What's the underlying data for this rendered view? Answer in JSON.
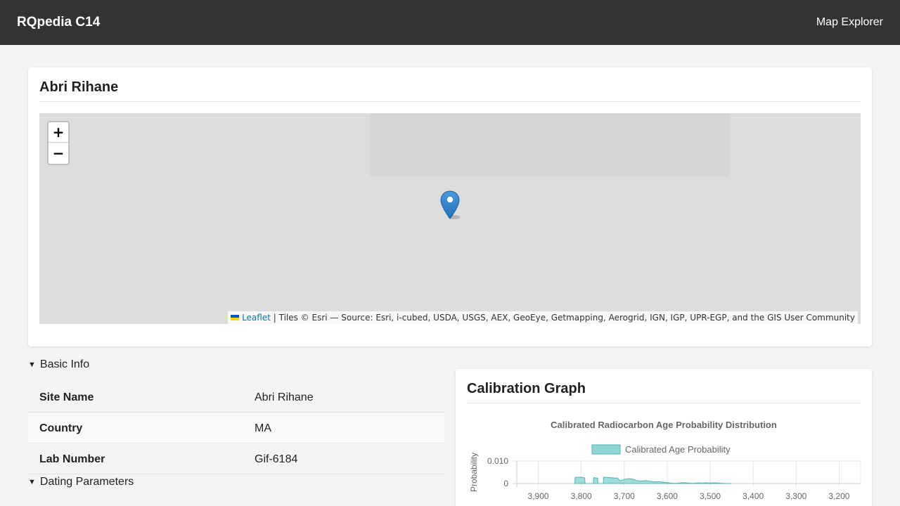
{
  "header": {
    "brand": "RQpedia C14",
    "nav_link": "Map Explorer"
  },
  "site": {
    "title": "Abri Rihane",
    "map": {
      "zoom_in": "+",
      "zoom_out": "−",
      "attribution_link": "Leaflet",
      "attribution_text": "| Tiles © Esri — Source: Esri, i-cubed, USDA, USGS, AEX, GeoEye, Getmapping, Aerogrid, IGN, IGP, UPR-EGP, and the GIS User Community"
    }
  },
  "basic_info": {
    "summary": "Basic Info",
    "rows": [
      {
        "label": "Site Name",
        "value": "Abri Rihane"
      },
      {
        "label": "Country",
        "value": "MA"
      },
      {
        "label": "Lab Number",
        "value": "Gif-6184"
      }
    ]
  },
  "dating": {
    "summary": "Dating Parameters"
  },
  "calibration": {
    "title": "Calibration Graph"
  },
  "chart_data": {
    "type": "area",
    "title": "Calibrated Radiocarbon Age Probability Distribution",
    "xlabel": "",
    "ylabel": "Probability",
    "legend": {
      "label": "Calibrated Age Probability",
      "position": "top"
    },
    "color": "#8fd6d3",
    "stroke": "#4fb3b0",
    "x_reversed": true,
    "xlim": [
      3950,
      3150
    ],
    "ylim": [
      0,
      0.01
    ],
    "x_ticks": [
      3900,
      3800,
      3700,
      3600,
      3500,
      3400,
      3300,
      3200
    ],
    "x_tick_labels": [
      "3,900",
      "3,800",
      "3,700",
      "3,600",
      "3,500",
      "3,400",
      "3,300",
      "3,200"
    ],
    "y_ticks": [
      0,
      0.01
    ],
    "y_tick_labels": [
      "0",
      "0.010"
    ],
    "grid": true,
    "series": [
      {
        "name": "Calibrated Age Probability",
        "x": [
          3815,
          3814,
          3810,
          3800,
          3792,
          3791,
          3790,
          3780,
          3772,
          3771,
          3762,
          3761,
          3760,
          3750,
          3749,
          3748,
          3747,
          3740,
          3730,
          3720,
          3716,
          3710,
          3700,
          3690,
          3680,
          3670,
          3660,
          3650,
          3640,
          3630,
          3620,
          3610,
          3600,
          3590,
          3580,
          3570,
          3560,
          3550,
          3540,
          3530,
          3520,
          3510,
          3500,
          3490,
          3480,
          3470,
          3460,
          3450
        ],
        "y": [
          0,
          0.0028,
          0.0028,
          0.0028,
          0.0025,
          0,
          0,
          0,
          0,
          0.0026,
          0.0024,
          0,
          0,
          0,
          0,
          0.0028,
          0.0028,
          0.0027,
          0.0026,
          0.0024,
          0.0025,
          0.0012,
          0.0018,
          0.0022,
          0.0019,
          0.0013,
          0.0011,
          0.0013,
          0.001,
          0.0007,
          0.0008,
          0.0006,
          0.0004,
          0.0002,
          0.0001,
          0.0003,
          0.0004,
          0.0002,
          0.0001,
          0.0003,
          0.0002,
          0.0003,
          0.0002,
          0.0003,
          0.0002,
          0.0001,
          0,
          0
        ]
      }
    ]
  }
}
